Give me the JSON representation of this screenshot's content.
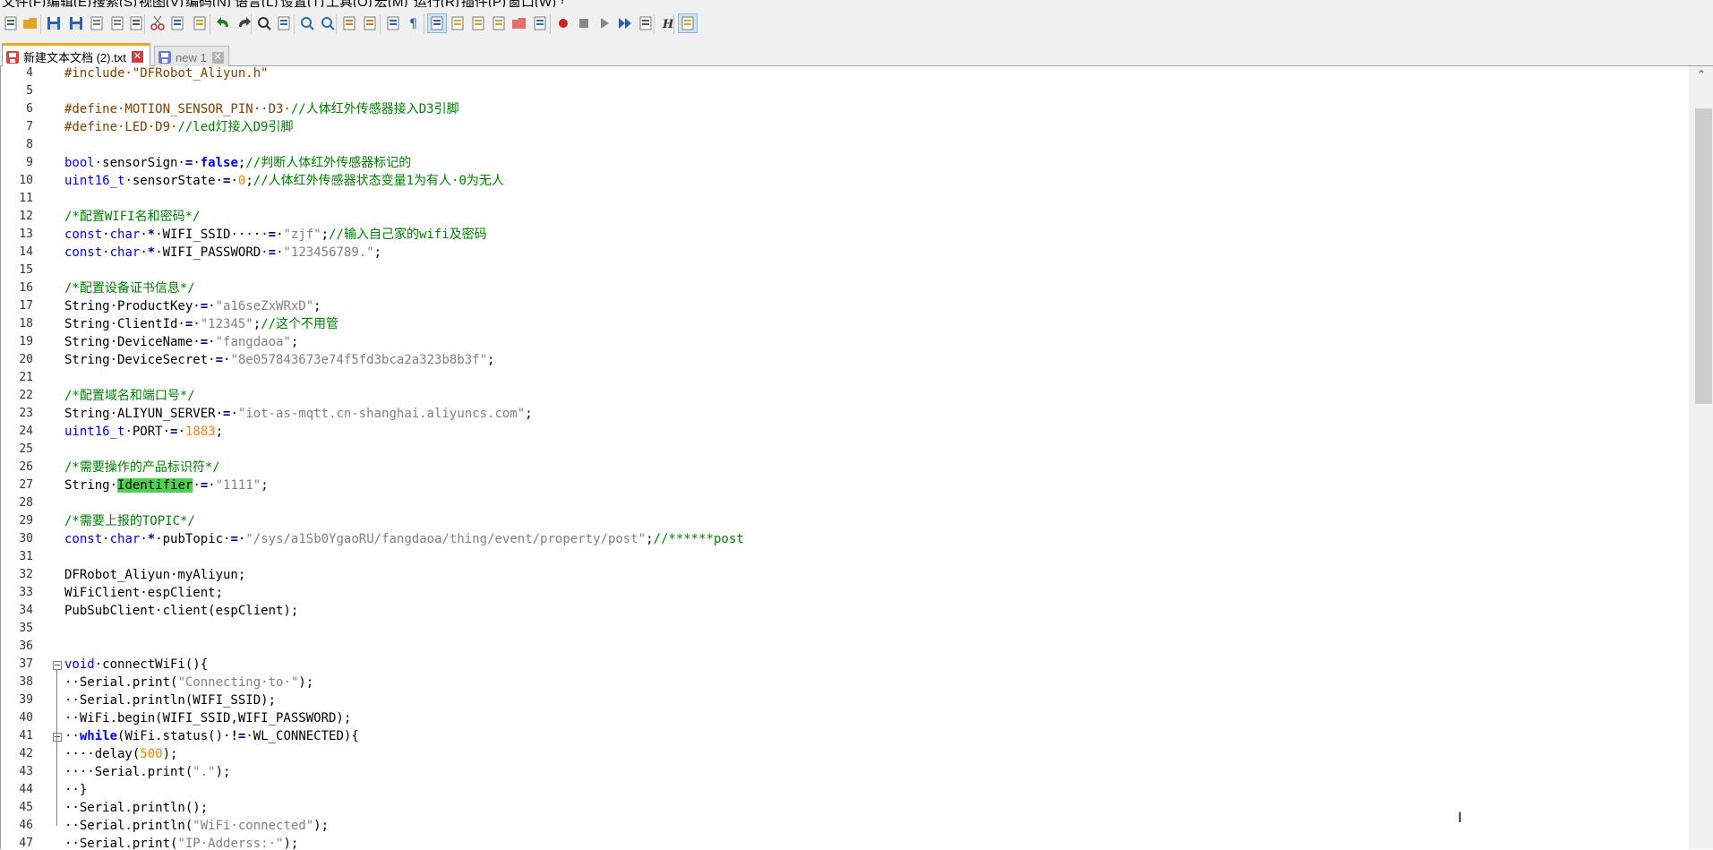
{
  "menu": [
    "文件(F)",
    "编辑(E)",
    "搜索(S)",
    "视图(V)",
    "编码(N)",
    "语言(L)",
    "设置(T)",
    "工具(O)",
    "宏(M)",
    "运行(R)",
    "插件(P)",
    "窗口(W)",
    "?"
  ],
  "toolbar_icons": [
    "new-file",
    "open-folder",
    "save",
    "save-all",
    "close",
    "close-all",
    "print",
    "cut",
    "copy",
    "paste",
    "undo",
    "redo",
    "find",
    "replace",
    "zoom-in",
    "zoom-out",
    "sync-vertical",
    "sync-horizontal",
    "word-wrap",
    "show-all-chars",
    "indent-guide",
    "define-language",
    "doc-map",
    "function-list",
    "folder-workspace",
    "monitor",
    "record-macro",
    "stop-record",
    "play-macro",
    "run-macro-multiple",
    "save-macro",
    "html-tag",
    "panel"
  ],
  "tabs": [
    {
      "name": "新建文本文档 (2).txt",
      "active": true,
      "close": "✕"
    },
    {
      "name": "new 1",
      "active": false,
      "close": "✕"
    }
  ],
  "scroll_up_glyph": "⌃",
  "text_cursor_glyph": "I",
  "code_lines": [
    {
      "n": "4",
      "t": [
        [
          "pre",
          "#include·\"DFRobot_Aliyun.h\""
        ]
      ]
    },
    {
      "n": "5",
      "t": []
    },
    {
      "n": "6",
      "t": [
        [
          "pre",
          "#define·MOTION_SENSOR_PIN··D3·"
        ],
        [
          "cmt",
          "//人体红外传感器接入D3引脚"
        ]
      ]
    },
    {
      "n": "7",
      "t": [
        [
          "pre",
          "#define·LED·D9·"
        ],
        [
          "cmt",
          "//led灯接入D9引脚"
        ]
      ]
    },
    {
      "n": "8",
      "t": []
    },
    {
      "n": "9",
      "t": [
        [
          "kw",
          "bool"
        ],
        [
          "",
          "·sensorSign·"
        ],
        [
          "op",
          "="
        ],
        [
          "",
          "·"
        ],
        [
          "kwb",
          "false"
        ],
        [
          "",
          ";"
        ],
        [
          "cmt",
          "//判断人体红外传感器标记的"
        ]
      ]
    },
    {
      "n": "10",
      "t": [
        [
          "kw",
          "uint16_t"
        ],
        [
          "",
          "·sensorState·"
        ],
        [
          "op",
          "="
        ],
        [
          "",
          "·"
        ],
        [
          "num",
          "0"
        ],
        [
          "",
          ";"
        ],
        [
          "cmt",
          "//人体红外传感器状态变量1为有人·0为无人"
        ]
      ]
    },
    {
      "n": "11",
      "t": []
    },
    {
      "n": "12",
      "t": [
        [
          "cmt",
          "/*配置WIFI名和密码*/"
        ]
      ]
    },
    {
      "n": "13",
      "t": [
        [
          "kw",
          "const"
        ],
        [
          "",
          "·"
        ],
        [
          "kw",
          "char"
        ],
        [
          "",
          "·"
        ],
        [
          "op",
          "*"
        ],
        [
          "",
          "·WIFI_SSID·····"
        ],
        [
          "op",
          "="
        ],
        [
          "",
          "·"
        ],
        [
          "str",
          "\"zjf\""
        ],
        [
          "",
          ";"
        ],
        [
          "cmt",
          "//输入自己家的wifi及密码"
        ]
      ]
    },
    {
      "n": "14",
      "t": [
        [
          "kw",
          "const"
        ],
        [
          "",
          "·"
        ],
        [
          "kw",
          "char"
        ],
        [
          "",
          "·"
        ],
        [
          "op",
          "*"
        ],
        [
          "",
          "·WIFI_PASSWORD·"
        ],
        [
          "op",
          "="
        ],
        [
          "",
          "·"
        ],
        [
          "str",
          "\"123456789.\""
        ],
        [
          "",
          ";"
        ]
      ]
    },
    {
      "n": "15",
      "t": []
    },
    {
      "n": "16",
      "t": [
        [
          "cmt",
          "/*配置设备证书信息*/"
        ]
      ]
    },
    {
      "n": "17",
      "t": [
        [
          "",
          "String·ProductKey·"
        ],
        [
          "op",
          "="
        ],
        [
          "",
          "·"
        ],
        [
          "str",
          "\"a16seZxWRxD\""
        ],
        [
          "",
          ";"
        ]
      ]
    },
    {
      "n": "18",
      "t": [
        [
          "",
          "String·ClientId·"
        ],
        [
          "op",
          "="
        ],
        [
          "",
          "·"
        ],
        [
          "str",
          "\"12345\""
        ],
        [
          "",
          ";"
        ],
        [
          "cmt",
          "//这个不用管"
        ]
      ]
    },
    {
      "n": "19",
      "t": [
        [
          "",
          "String·DeviceName·"
        ],
        [
          "op",
          "="
        ],
        [
          "",
          "·"
        ],
        [
          "str",
          "\"fangdaoa\""
        ],
        [
          "",
          ";"
        ]
      ]
    },
    {
      "n": "20",
      "t": [
        [
          "",
          "String·DeviceSecret·"
        ],
        [
          "op",
          "="
        ],
        [
          "",
          "·"
        ],
        [
          "str",
          "\"8e057843673e74f5fd3bca2a323b8b3f\""
        ],
        [
          "",
          ";"
        ]
      ]
    },
    {
      "n": "21",
      "t": []
    },
    {
      "n": "22",
      "t": [
        [
          "cmt",
          "/*配置域名和端口号*/"
        ]
      ]
    },
    {
      "n": "23",
      "t": [
        [
          "",
          "String·ALIYUN_SERVER·"
        ],
        [
          "op",
          "="
        ],
        [
          "",
          "·"
        ],
        [
          "str",
          "\"iot-as-mqtt.cn-shanghai.aliyuncs.com\""
        ],
        [
          "",
          ";"
        ]
      ]
    },
    {
      "n": "24",
      "t": [
        [
          "kw",
          "uint16_t"
        ],
        [
          "",
          "·PORT·"
        ],
        [
          "op",
          "="
        ],
        [
          "",
          "·"
        ],
        [
          "num",
          "1883"
        ],
        [
          "",
          ";"
        ]
      ]
    },
    {
      "n": "25",
      "t": []
    },
    {
      "n": "26",
      "t": [
        [
          "cmt",
          "/*需要操作的产品标识符*/"
        ]
      ]
    },
    {
      "n": "27",
      "t": [
        [
          "",
          "String·"
        ],
        [
          "hl",
          "Identifier"
        ],
        [
          "",
          "·"
        ],
        [
          "op",
          "="
        ],
        [
          "",
          "·"
        ],
        [
          "str",
          "\"1111\""
        ],
        [
          "",
          ";"
        ]
      ]
    },
    {
      "n": "28",
      "t": []
    },
    {
      "n": "29",
      "t": [
        [
          "cmt",
          "/*需要上报的TOPIC*/"
        ]
      ]
    },
    {
      "n": "30",
      "t": [
        [
          "kw",
          "const"
        ],
        [
          "",
          "·"
        ],
        [
          "kw",
          "char"
        ],
        [
          "",
          "·"
        ],
        [
          "op",
          "*"
        ],
        [
          "",
          "·pubTopic·"
        ],
        [
          "op",
          "="
        ],
        [
          "",
          "·"
        ],
        [
          "str",
          "\"/sys/a1Sb0YgaoRU/fangdaoa/thing/event/property/post\""
        ],
        [
          "",
          ";"
        ],
        [
          "cmt",
          "//******post"
        ]
      ]
    },
    {
      "n": "31",
      "t": []
    },
    {
      "n": "32",
      "t": [
        [
          "",
          "DFRobot_Aliyun·myAliyun;"
        ]
      ]
    },
    {
      "n": "33",
      "t": [
        [
          "",
          "WiFiClient·espClient;"
        ]
      ]
    },
    {
      "n": "34",
      "t": [
        [
          "",
          "PubSubClient·client(espClient);"
        ]
      ]
    },
    {
      "n": "35",
      "t": []
    },
    {
      "n": "36",
      "t": []
    },
    {
      "n": "37",
      "t": [
        [
          "kw",
          "void"
        ],
        [
          "",
          "·connectWiFi(){"
        ]
      ]
    },
    {
      "n": "38",
      "t": [
        [
          "",
          "··Serial.print("
        ],
        [
          "str",
          "\"Connecting·to·\""
        ],
        [
          "",
          ");"
        ]
      ]
    },
    {
      "n": "39",
      "t": [
        [
          "",
          "··Serial.println(WIFI_SSID);"
        ]
      ]
    },
    {
      "n": "40",
      "t": [
        [
          "",
          "··WiFi.begin(WIFI_SSID,WIFI_PASSWORD);"
        ]
      ]
    },
    {
      "n": "41",
      "t": [
        [
          "",
          "··"
        ],
        [
          "kwb",
          "while"
        ],
        [
          "",
          "(WiFi.status()·"
        ],
        [
          "op",
          "!="
        ],
        [
          "",
          "·WL_CONNECTED){"
        ]
      ]
    },
    {
      "n": "42",
      "t": [
        [
          "",
          "····delay("
        ],
        [
          "num",
          "500"
        ],
        [
          "",
          ");"
        ]
      ]
    },
    {
      "n": "43",
      "t": [
        [
          "",
          "····Serial.print("
        ],
        [
          "str",
          "\".\""
        ],
        [
          "",
          ");"
        ]
      ]
    },
    {
      "n": "44",
      "t": [
        [
          "",
          "··}"
        ]
      ]
    },
    {
      "n": "45",
      "t": [
        [
          "",
          "··Serial.println();"
        ]
      ]
    },
    {
      "n": "46",
      "t": [
        [
          "",
          "··Serial.println("
        ],
        [
          "str",
          "\"WiFi·connected\""
        ],
        [
          "",
          ");"
        ]
      ]
    },
    {
      "n": "47",
      "t": [
        [
          "",
          "··Serial.print("
        ],
        [
          "str",
          "\"IP·Adderss:·\""
        ],
        [
          "",
          ");"
        ]
      ]
    }
  ]
}
